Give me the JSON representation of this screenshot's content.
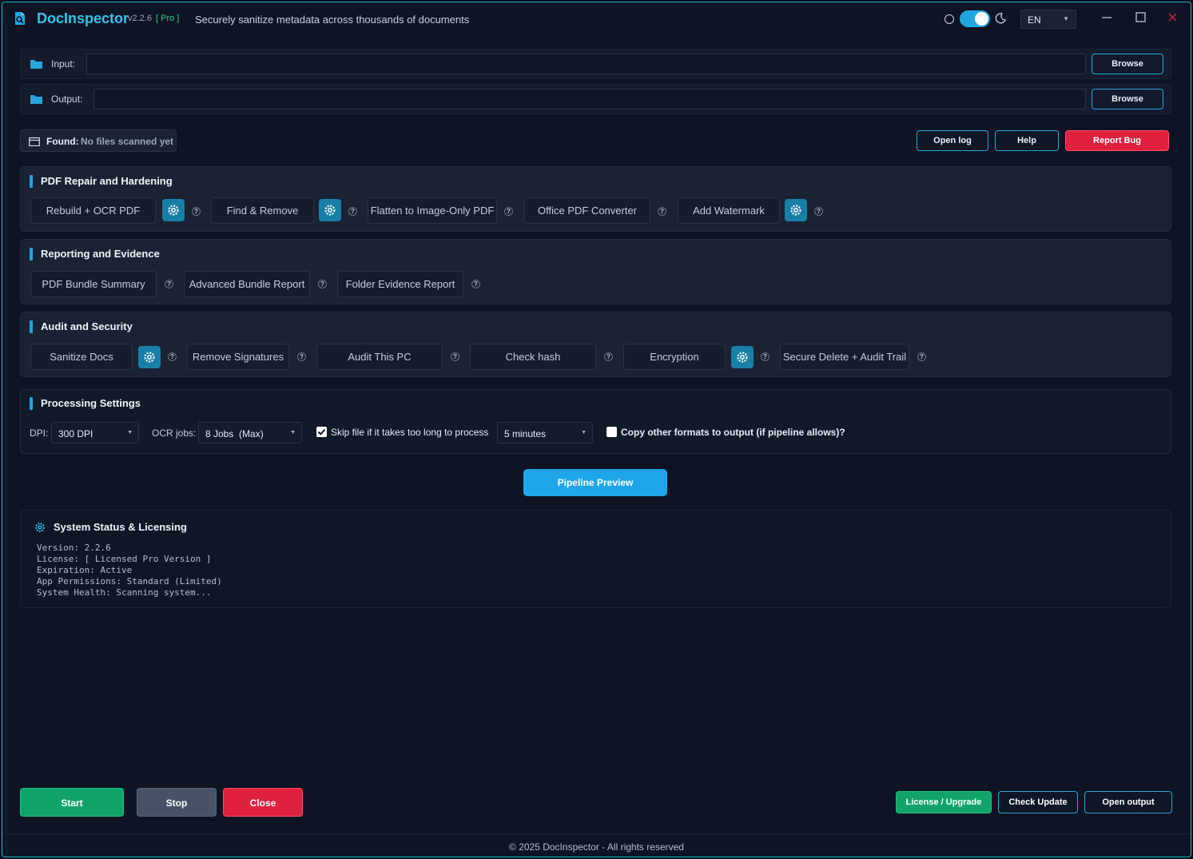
{
  "app": {
    "name": "DocInspector",
    "version": "v2.2.6",
    "edition": "[ Pro ]",
    "tagline": "Securely sanitize metadata across thousands of documents",
    "language": "EN"
  },
  "input": {
    "label": "Input:",
    "value": "",
    "browse": "Browse"
  },
  "output": {
    "label": "Output:",
    "value": "",
    "browse": "Browse"
  },
  "found": {
    "label": "Found:",
    "value": "No files scanned yet"
  },
  "top_actions": {
    "open_log": "Open log",
    "help": "Help",
    "report_bug": "Report Bug"
  },
  "sections": {
    "pdf": {
      "title": "PDF Repair and Hardening",
      "tools": [
        "Rebuild + OCR PDF",
        "Find & Remove",
        "Flatten to Image-Only PDF",
        "Office PDF Converter",
        "Add Watermark"
      ]
    },
    "reporting": {
      "title": "Reporting and Evidence",
      "tools": [
        "PDF Bundle Summary",
        "Advanced Bundle Report",
        "Folder Evidence Report"
      ]
    },
    "audit": {
      "title": "Audit and Security",
      "tools": [
        "Sanitize Docs",
        "Remove Signatures",
        "Audit This PC",
        "Check hash",
        "Encryption",
        "Secure Delete + Audit Trail"
      ]
    }
  },
  "help_glyph": "?",
  "processing": {
    "title": "Processing Settings",
    "dpi_label": "DPI:",
    "dpi_value": "300 DPI",
    "ocr_label": "OCR jobs:",
    "ocr_value": "8 Jobs  (Max)",
    "skip_label": "Skip file if it takes too long to process",
    "skip_checked": true,
    "timeout_value": "5 minutes",
    "copy_label": "Copy other formats to output (if pipeline allows)?",
    "copy_checked": false
  },
  "pipeline_preview": "Pipeline Preview",
  "status": {
    "title": "System Status & Licensing",
    "lines": [
      "Version: 2.2.6",
      "License: [ Licensed Pro Version ]",
      "Expiration: Active",
      "App Permissions: Standard (Limited)",
      "System Health: Scanning system..."
    ]
  },
  "bottom": {
    "start": "Start",
    "stop": "Stop",
    "close": "Close",
    "license": "License / Upgrade",
    "check_update": "Check Update",
    "open_output": "Open output"
  },
  "footer": "© 2025 DocInspector - All rights reserved",
  "colors": {
    "accent": "#1fa6e0",
    "danger": "#e0203f",
    "success": "#12a36a",
    "background": "#0e1424"
  }
}
